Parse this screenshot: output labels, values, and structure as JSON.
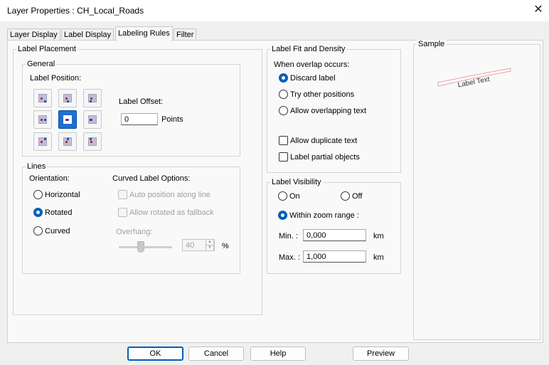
{
  "window": {
    "title": "Layer Properties  : CH_Local_Roads",
    "close_glyph": "✕"
  },
  "tabs": [
    {
      "label": "Layer Display",
      "active": false
    },
    {
      "label": "Label Display",
      "active": false
    },
    {
      "label": "Labeling Rules",
      "active": true
    },
    {
      "label": "Filter",
      "active": false
    }
  ],
  "label_placement": {
    "legend": "Label Placement",
    "general": {
      "legend": "General",
      "position_label": "Label Position:",
      "offset_label": "Label Offset:",
      "offset_value": "0",
      "offset_unit": "Points"
    },
    "lines": {
      "legend": "Lines",
      "orientation_label": "Orientation:",
      "orientations": [
        {
          "label": "Horizontal",
          "selected": false
        },
        {
          "label": "Rotated",
          "selected": true
        },
        {
          "label": "Curved",
          "selected": false
        }
      ],
      "curved_label": "Curved Label Options:",
      "auto_position": "Auto position along line",
      "allow_rotated": "Allow rotated as fallback",
      "overhang_label": "Overhang:",
      "overhang_value": "40",
      "overhang_unit": "%",
      "overhang_fraction": 0.4
    }
  },
  "fit_density": {
    "legend": "Label Fit and Density",
    "overlap_label": "When overlap occurs:",
    "overlap_options": [
      {
        "label": "Discard label",
        "selected": true
      },
      {
        "label": "Try other positions",
        "selected": false
      },
      {
        "label": "Allow overlapping text",
        "selected": false
      }
    ],
    "allow_duplicate": "Allow duplicate text",
    "label_partial": "Label partial objects"
  },
  "visibility": {
    "legend": "Label Visibility",
    "on": "On",
    "off": "Off",
    "within": "Within zoom range :",
    "min_label": "Min. :",
    "min_value": "0,000",
    "max_label": "Max. :",
    "max_value": "1,000",
    "unit": "km"
  },
  "sample": {
    "legend": "Sample",
    "text": "Label Text"
  },
  "buttons": {
    "ok": "OK",
    "cancel": "Cancel",
    "help": "Help",
    "preview": "Preview"
  }
}
